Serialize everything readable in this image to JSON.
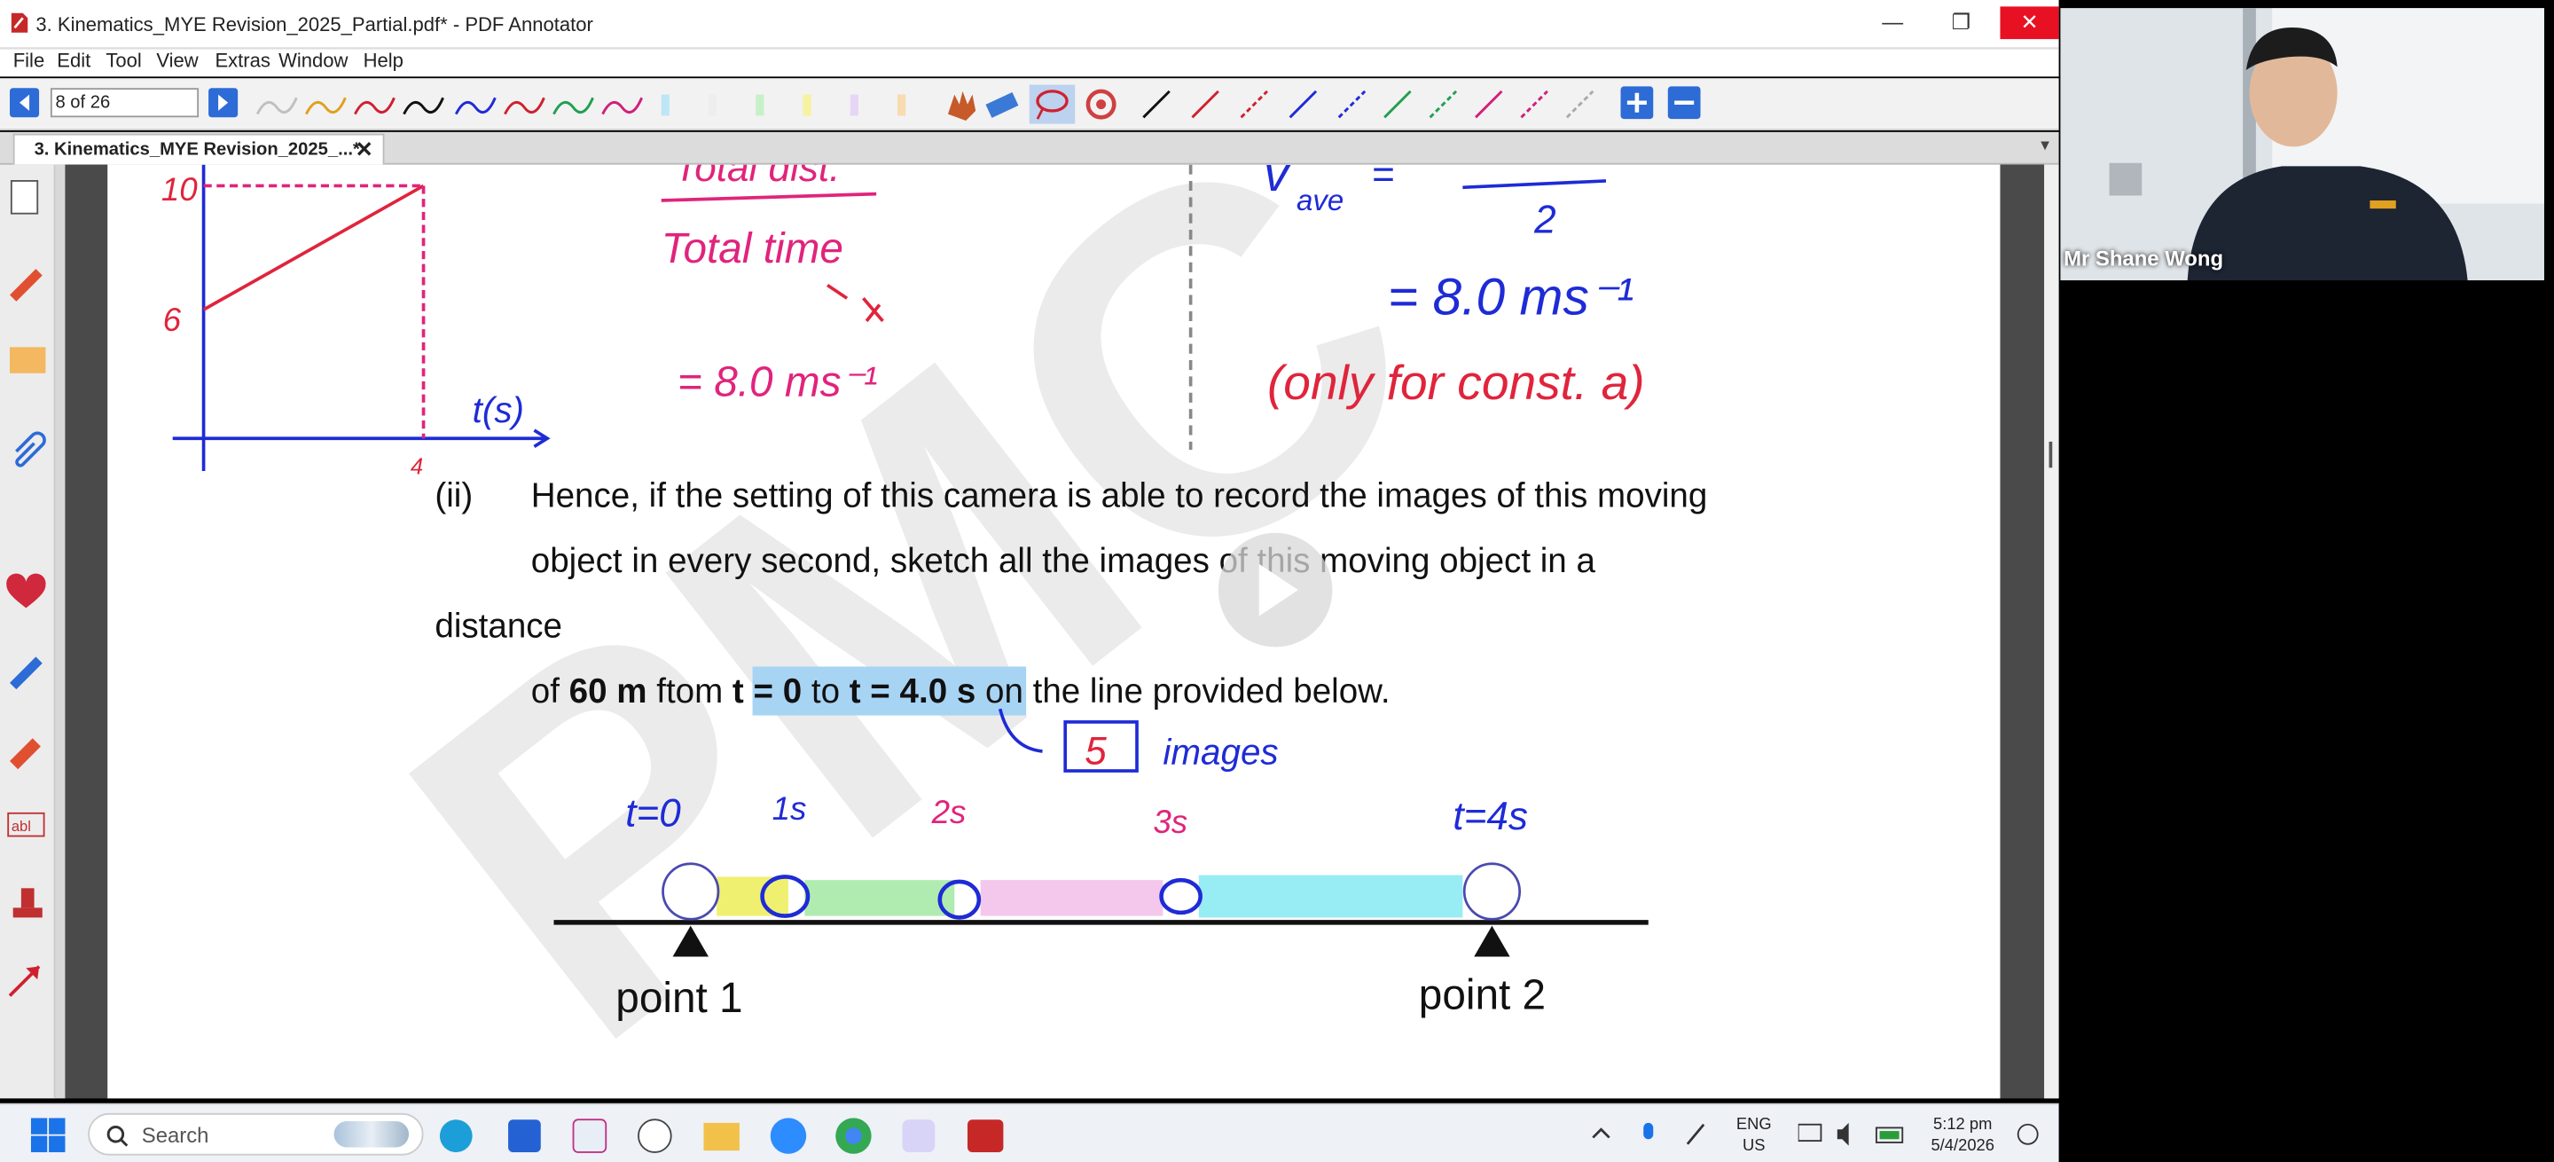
{
  "window": {
    "title": "3. Kinematics_MYE Revision_2025_Partial.pdf* - PDF Annotator",
    "menu": [
      "File",
      "Edit",
      "Tool",
      "View",
      "Extras",
      "Window",
      "Help"
    ]
  },
  "toolbar": {
    "page_field": "8 of 26"
  },
  "tab": {
    "label": "3. Kinematics_MYE Revision_2025_...*",
    "close": "✕"
  },
  "page": {
    "handwriting_top": {
      "total_dist": "Total dist.",
      "total_time": "Total time",
      "eq1": "= 8.0 ms⁻¹",
      "vave": "v",
      "vave_sub": "ave",
      "eq_sign": "=",
      "two": "2",
      "eq2": "= 8.0 ms⁻¹",
      "note": "(only for const. a)"
    },
    "graph": {
      "y_top": "10",
      "y_mid": "6",
      "x_end": "4",
      "x_label": "t(s)"
    },
    "question": {
      "number": "(ii)",
      "line1": "Hence, if the setting of this camera is able to record the images of this moving",
      "line2": "object in every second, sketch all the images of this moving object in a",
      "line3": "distance",
      "line4_a": "of ",
      "line4_b": "60 m",
      "line4_c": " ftom ",
      "line4_d": "t = 0",
      "line4_e": " to ",
      "line4_f": "t = 4.0 s",
      "line4_g": " on the line provided below."
    },
    "annotations": {
      "count": "5",
      "images": "images",
      "t0": "t=0",
      "t1": "1s",
      "t2": "2s",
      "t3": "3s",
      "t4": "t=4s"
    },
    "points": {
      "p1": "point 1",
      "p2": "point 2"
    },
    "watermark": "PMC"
  },
  "taskbar": {
    "search_placeholder": "Search",
    "lang": "ENG",
    "region": "US",
    "time": "5:12 pm",
    "date": "5/4/2026"
  },
  "webcam": {
    "name": "Mr Shane Wong"
  },
  "colors": {
    "accent": "#2d6bd6",
    "close": "#e81123",
    "ink_red": "#e0243c",
    "ink_blue": "#1e2bd6",
    "ink_pink": "#e0247c"
  }
}
